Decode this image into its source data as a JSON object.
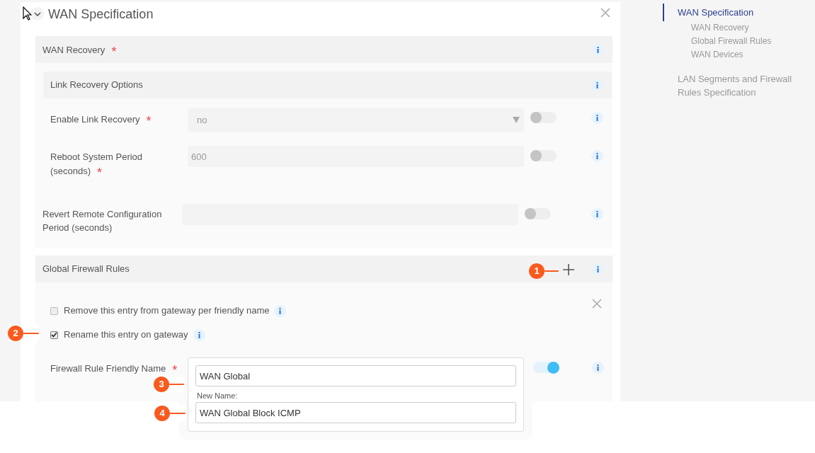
{
  "panel": {
    "title": "WAN Specification"
  },
  "wan_recovery": {
    "label": "WAN Recovery",
    "required_mark": "*",
    "link_recovery_options": {
      "label": "Link Recovery Options",
      "fields": [
        {
          "kind": "select",
          "label": "Enable Link Recovery",
          "required_mark": "*",
          "value": "no",
          "toggle_on": false
        },
        {
          "kind": "text",
          "label": "Reboot System Period (seconds)",
          "required_mark": "*",
          "value": "600",
          "toggle_on": false
        }
      ]
    },
    "revert_field": {
      "kind": "text",
      "label": "Revert Remote Configuration Period (seconds)",
      "toggle_on": false
    }
  },
  "global_firewall_rules": {
    "label": "Global Firewall Rules",
    "checkboxes": [
      {
        "label": "Remove this entry from gateway per friendly name",
        "checked": false
      },
      {
        "label": "Rename this entry on gateway",
        "checked": true
      }
    ],
    "friendly_name": {
      "label": "Firewall Rule Friendly Name",
      "required_mark": "*",
      "toggle_on": true,
      "value": "WAN Global",
      "new_name_label": "New Name:",
      "new_name": "WAN Global Block ICMP"
    }
  },
  "callouts": [
    {
      "number": "1"
    },
    {
      "number": "2"
    },
    {
      "number": "3"
    },
    {
      "number": "4"
    }
  ],
  "nav": [
    {
      "label": "WAN Specification",
      "selected": true,
      "children": [
        {
          "label": "WAN Recovery",
          "selected": false
        },
        {
          "label": "Global Firewall Rules",
          "selected": false
        },
        {
          "label": "WAN Devices",
          "selected": false
        }
      ]
    },
    {
      "label": "LAN Segments and Firewall Rules Specification",
      "selected": false
    }
  ]
}
